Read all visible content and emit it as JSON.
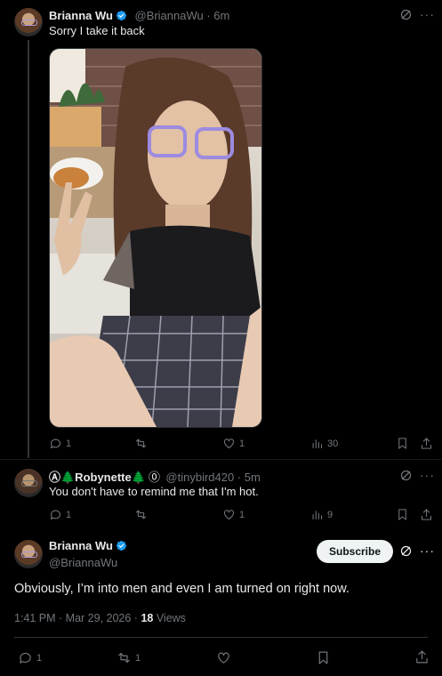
{
  "tweet1": {
    "name": "Brianna Wu",
    "handle": "@BriannaWu",
    "time": "6m",
    "text": "Sorry I take it back",
    "replies": "1",
    "retweets": "",
    "likes": "1",
    "views": "30"
  },
  "tweet2": {
    "name": "Ⓐ🌲Robynette🌲",
    "handle": "@tinybird420",
    "time": "5m",
    "text": "You don't have to remind me that I'm hot.",
    "replies": "1",
    "retweets": "",
    "likes": "1",
    "views": "9"
  },
  "tweet3": {
    "name": "Brianna Wu",
    "handle": "@BriannaWu",
    "subscribe_label": "Subscribe",
    "text": "Obviously, I’m into men and even I am turned on right now.",
    "timestamp": "1:41 PM · Mar 29, 2026 · ",
    "views_count": "18",
    "views_label": " Views",
    "replies": "1",
    "retweets": "1"
  },
  "separator": " · ",
  "colors": {
    "background": "#000000",
    "text": "#e7e9ea",
    "muted": "#71767b",
    "verified": "#1d9bf0",
    "divider": "#2f3336"
  }
}
